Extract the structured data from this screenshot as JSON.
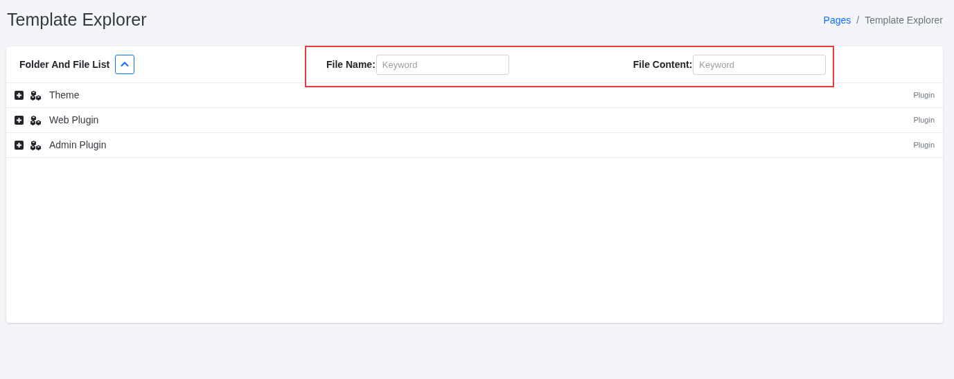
{
  "page_title": "Template Explorer",
  "breadcrumb": [
    {
      "label": "Pages",
      "link": true
    },
    {
      "label": "Template Explorer",
      "link": false
    }
  ],
  "breadcrumb_separator": "/",
  "panel": {
    "title": "Folder And File List",
    "collapsed": false,
    "filters": [
      {
        "label": "File Name:",
        "placeholder": "Keyword"
      },
      {
        "label": "File Content:",
        "placeholder": "Keyword"
      }
    ],
    "items": [
      {
        "label": "Theme",
        "type": "Plugin",
        "expanded": false
      },
      {
        "label": "Web Plugin",
        "type": "Plugin",
        "expanded": false
      },
      {
        "label": "Admin Plugin",
        "type": "Plugin",
        "expanded": false
      }
    ]
  },
  "highlight": {
    "shown": true
  }
}
